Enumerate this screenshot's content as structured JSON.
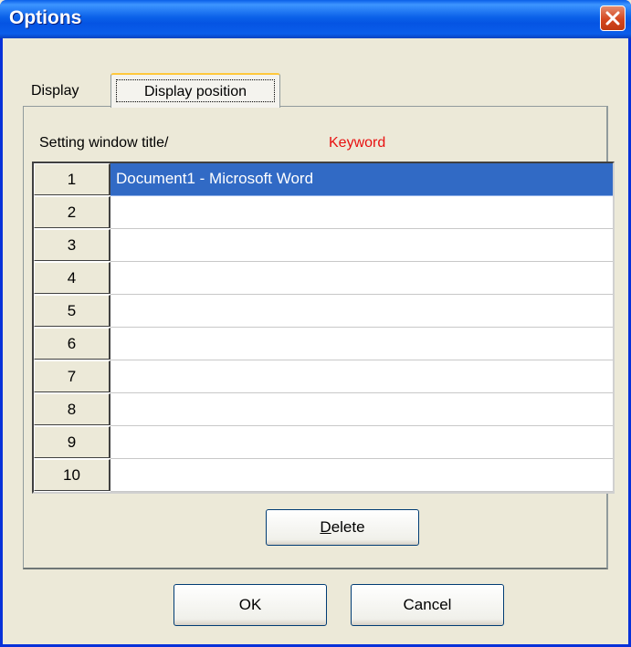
{
  "window": {
    "title": "Options"
  },
  "tabs": [
    {
      "label": "Display",
      "active": false
    },
    {
      "label": "Display position",
      "active": true
    }
  ],
  "panel": {
    "setting_label": "Setting window title/",
    "keyword_label": "Keyword",
    "keyword_color": "#E81010",
    "rows": [
      {
        "num": "1",
        "value": "Document1 - Microsoft Word",
        "selected": true
      },
      {
        "num": "2",
        "value": ""
      },
      {
        "num": "3",
        "value": ""
      },
      {
        "num": "4",
        "value": ""
      },
      {
        "num": "5",
        "value": ""
      },
      {
        "num": "6",
        "value": ""
      },
      {
        "num": "7",
        "value": ""
      },
      {
        "num": "8",
        "value": ""
      },
      {
        "num": "9",
        "value": ""
      },
      {
        "num": "10",
        "value": ""
      }
    ],
    "delete_label_mnemonic": "D",
    "delete_label_rest": "elete"
  },
  "buttons": {
    "ok": "OK",
    "cancel": "Cancel"
  },
  "colors": {
    "selection": "#316AC5",
    "titlebar": "#0554E3",
    "close": "#D4471F"
  },
  "icons": {
    "close": "close-icon"
  }
}
